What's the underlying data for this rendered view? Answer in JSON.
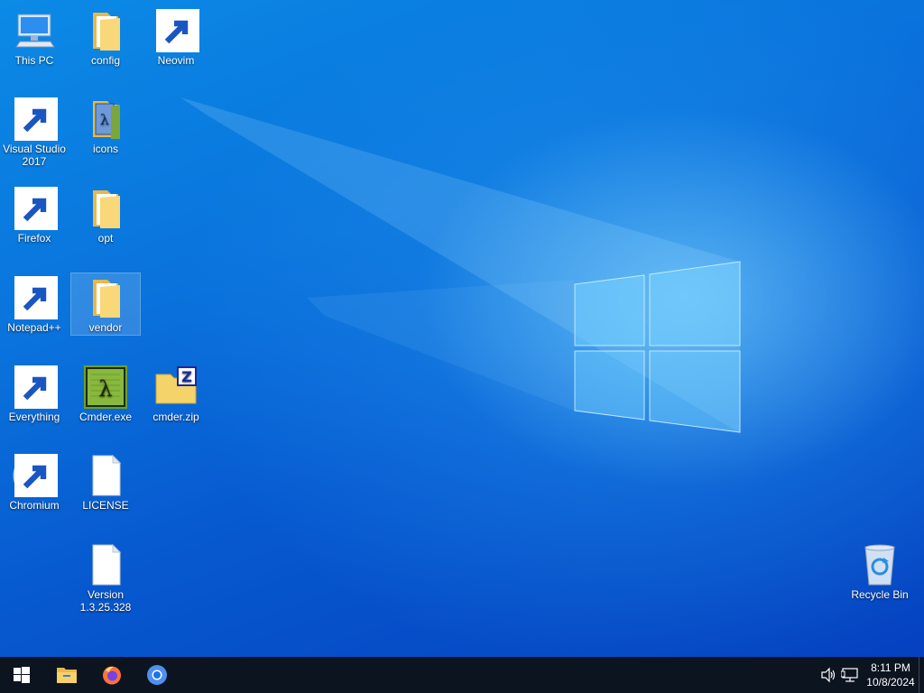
{
  "desktop": {
    "icons": [
      {
        "label": "This PC",
        "icon": "this-pc-icon"
      },
      {
        "label": "config",
        "icon": "folder-icon"
      },
      {
        "label": "Neovim",
        "icon": "neovim-icon"
      },
      {
        "label": "Visual Studio 2017",
        "icon": "visual-studio-icon"
      },
      {
        "label": "icons",
        "icon": "folder-icon"
      },
      {
        "label": "Firefox",
        "icon": "firefox-icon"
      },
      {
        "label": "opt",
        "icon": "folder-icon"
      },
      {
        "label": "Notepad++",
        "icon": "notepad-plus-plus-icon"
      },
      {
        "label": "vendor",
        "icon": "folder-icon",
        "selected": true
      },
      {
        "label": "Everything",
        "icon": "everything-search-icon"
      },
      {
        "label": "Cmder.exe",
        "icon": "cmder-icon"
      },
      {
        "label": "cmder.zip",
        "icon": "zip-folder-icon"
      },
      {
        "label": "Chromium",
        "icon": "chromium-icon"
      },
      {
        "label": "LICENSE",
        "icon": "file-icon"
      },
      {
        "label": "Version 1.3.25.328",
        "icon": "file-icon"
      },
      {
        "label": "Recycle Bin",
        "icon": "recycle-bin-icon"
      }
    ]
  },
  "taskbar": {
    "pinned": [
      {
        "icon": "start-icon"
      },
      {
        "icon": "file-explorer-icon"
      },
      {
        "icon": "firefox-icon"
      },
      {
        "icon": "chromium-icon"
      }
    ],
    "tray": {
      "volume_icon": "volume-icon",
      "network_icon": "network-icon",
      "time": "8:11 PM",
      "date": "10/8/2024"
    }
  },
  "colors": {
    "desktop_blue": "#0a6fd6",
    "taskbar": "#0c1420",
    "selection": "rgba(255,255,255,0.16)"
  }
}
